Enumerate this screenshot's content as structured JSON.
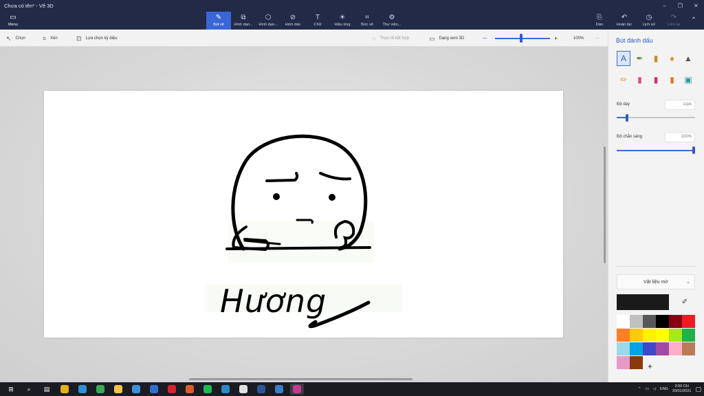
{
  "window": {
    "title": "Chưa có tên* - Vẽ 3D",
    "controls": [
      "–",
      "❐",
      "✕"
    ]
  },
  "ribbon": {
    "menu_label": "Menu",
    "tools": [
      {
        "label": "Bút vẽ",
        "icon": "brush-icon",
        "glyph": "✎"
      },
      {
        "label": "Hình dạn...",
        "icon": "shapes-2d-icon",
        "glyph": "⧉"
      },
      {
        "label": "Hình dạn...",
        "icon": "shapes-3d-icon",
        "glyph": "⬡"
      },
      {
        "label": "Hình dán",
        "icon": "stickers-icon",
        "glyph": "⊘"
      },
      {
        "label": "Chữ",
        "icon": "text-icon",
        "glyph": "T"
      },
      {
        "label": "Hiệu ứng",
        "icon": "effects-icon",
        "glyph": "☀"
      },
      {
        "label": "Bức vẽ",
        "icon": "canvas-icon",
        "glyph": "⌗"
      },
      {
        "label": "Thư viện...",
        "icon": "library-icon",
        "glyph": "⚙"
      }
    ],
    "right_tools": [
      {
        "label": "Dán",
        "icon": "paste-icon",
        "glyph": "⎘"
      },
      {
        "label": "Hoàn tác",
        "icon": "undo-icon",
        "glyph": "↶"
      },
      {
        "label": "Lịch sử",
        "icon": "history-icon",
        "glyph": "◷"
      },
      {
        "label": "Làm lại",
        "icon": "redo-icon",
        "glyph": "↷"
      }
    ]
  },
  "subbar": {
    "select": "Chọn",
    "crop": "Xén",
    "magic_select": "Lựa chọn kỳ diệu",
    "mixed_reality": "Thực tế kết hợp",
    "view_3d": "Dạng xem 3D",
    "zoom": "100%",
    "more": "···",
    "zoom_minus": "—",
    "zoom_plus": "+",
    "zoom_level": 0.45
  },
  "canvas": {
    "handwriting": "Hương"
  },
  "panel": {
    "title": "Bút đánh dấu",
    "thickness_label": "Độ dày",
    "thickness_value": "11px",
    "thickness_level": 0.11,
    "opacity_label": "Độ chắn sáng",
    "opacity_value": "100%",
    "opacity_level": 1.0,
    "material_label": "Vật liệu mờ",
    "brushes": [
      {
        "name": "marker-icon",
        "color": "#2f5bc3"
      },
      {
        "name": "calligraphy-pen-icon",
        "color": "#4a8a3a"
      },
      {
        "name": "oil-brush-icon",
        "color": "#c88a2a"
      },
      {
        "name": "watercolor-icon",
        "color": "#d98a1a"
      },
      {
        "name": "pixel-pen-icon",
        "color": "#555555"
      },
      {
        "name": "pencil-icon",
        "color": "#e0a030"
      },
      {
        "name": "eraser-icon",
        "color": "#e04a7a"
      },
      {
        "name": "crayon-icon",
        "color": "#d0306a"
      },
      {
        "name": "spray-can-icon",
        "color": "#e07a20"
      },
      {
        "name": "fill-bucket-icon",
        "color": "#2a9a9a"
      }
    ],
    "current_color": "#1a1a1a",
    "palette": [
      "#ffffff",
      "#c0c0c0",
      "#585858",
      "#000000",
      "#880015",
      "#ed1c24",
      "#ff7f27",
      "#ffc90e",
      "#fff200",
      "#ffff00",
      "#a8e61d",
      "#22b14c",
      "#99d9ea",
      "#00a2e8",
      "#3f48cc",
      "#a349a4",
      "#ffaec9",
      "#b97a57",
      "#e79ac6",
      "#8a3a0a"
    ],
    "add_label": "+"
  },
  "taskbar": {
    "apps": [
      {
        "name": "start-icon",
        "glyph": "⊞",
        "color": "#ffffff"
      },
      {
        "name": "search-icon",
        "glyph": "⌕",
        "color": "#ffffff"
      },
      {
        "name": "task-view-icon",
        "glyph": "▤",
        "color": "#ffffff"
      },
      {
        "name": "chrome-icon",
        "glyph": "",
        "color": "#e4b21b"
      },
      {
        "name": "edge-icon",
        "glyph": "",
        "color": "#2f8fd8"
      },
      {
        "name": "chrome-alt-icon",
        "glyph": "",
        "color": "#3aa757"
      },
      {
        "name": "file-explorer-icon",
        "glyph": "",
        "color": "#f2c14e"
      },
      {
        "name": "store-icon",
        "glyph": "",
        "color": "#3f8fd8"
      },
      {
        "name": "mail-icon",
        "glyph": "",
        "color": "#2f6fd0"
      },
      {
        "name": "pinterest-icon",
        "glyph": "",
        "color": "#d8232a"
      },
      {
        "name": "video-editor-icon",
        "glyph": "",
        "color": "#e05a2a"
      },
      {
        "name": "spotify-icon",
        "glyph": "",
        "color": "#1db954"
      },
      {
        "name": "photos-icon",
        "glyph": "",
        "color": "#2a8ac8"
      },
      {
        "name": "notifications-app-icon",
        "glyph": "",
        "color": "#e0e0e0"
      },
      {
        "name": "word-icon",
        "glyph": "",
        "color": "#2b579a"
      },
      {
        "name": "photo-viewer-icon",
        "glyph": "",
        "color": "#3b7ec8"
      },
      {
        "name": "paint-3d-icon",
        "glyph": "",
        "color": "#c83a8a"
      }
    ],
    "language": "ENG",
    "time": "3:50 CH",
    "date": "20/01/2021"
  }
}
